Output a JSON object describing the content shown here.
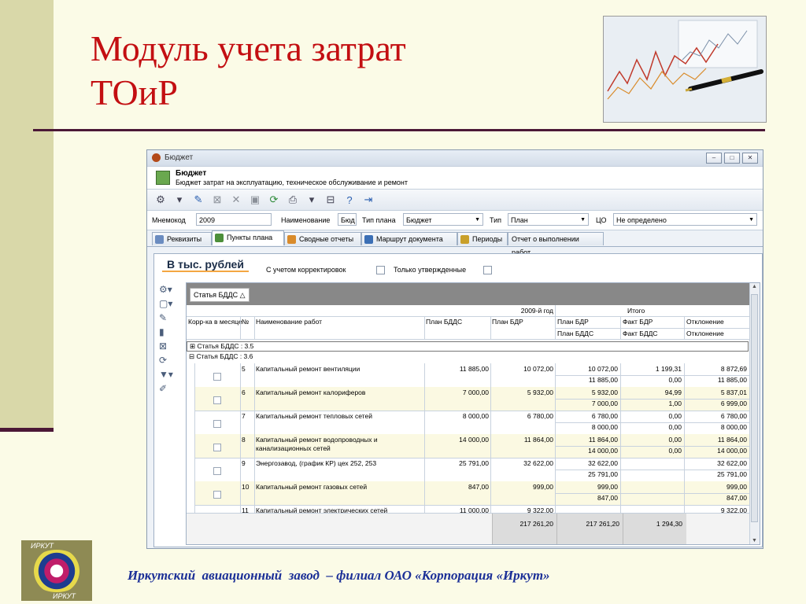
{
  "slide": {
    "title_line1": "Модуль учета затрат",
    "title_line2": "ТОиР",
    "footer": "Иркутский  авиационный  завод  – филиал ОАО «Корпорация «Иркут»",
    "logo_top": "ИРКУТ",
    "logo_bottom": "ИРКУТ"
  },
  "window": {
    "title": "Бюджет",
    "min_label": "–",
    "max_label": "□",
    "close_label": "✕",
    "header_title": "Бюджет",
    "header_subtitle": "Бюджет затрат на эксплуатацию, техническое обслуживание и ремонт"
  },
  "toolbar": {
    "items": [
      {
        "name": "settings-icon",
        "glyph": "⚙",
        "cls": ""
      },
      {
        "name": "dropdown-arrow-icon",
        "glyph": "▾",
        "cls": ""
      },
      {
        "name": "edit-icon",
        "glyph": "✎",
        "cls": "blue"
      },
      {
        "name": "cancel-icon",
        "glyph": "⊠",
        "cls": "grey"
      },
      {
        "name": "delete-icon",
        "glyph": "✕",
        "cls": "grey"
      },
      {
        "name": "save-icon",
        "glyph": "▣",
        "cls": "grey"
      },
      {
        "name": "refresh-icon",
        "glyph": "⟳",
        "cls": "green"
      },
      {
        "name": "print-icon",
        "glyph": "⎙",
        "cls": ""
      },
      {
        "name": "dropdown-arrow-icon",
        "glyph": "▾",
        "cls": ""
      },
      {
        "name": "export-icon",
        "glyph": "⊟",
        "cls": ""
      },
      {
        "name": "help-icon",
        "glyph": "?",
        "cls": "blue"
      },
      {
        "name": "exit-icon",
        "glyph": "⇥",
        "cls": "blue"
      }
    ]
  },
  "filters": {
    "mnemo_label": "Мнемокод",
    "mnemo_value": "2009",
    "name_label": "Наименование",
    "name_value": "Бюд",
    "plan_type_label": "Тип плана",
    "plan_type_value": "Бюджет",
    "type_label": "Тип",
    "type_value": "План",
    "cfo_label": "ЦО",
    "cfo_value": "Не определено"
  },
  "tabs": [
    {
      "label": "Реквизиты",
      "color": "#6b8cc0",
      "active": false
    },
    {
      "label": "Пункты плана",
      "color": "#4d8f3a",
      "active": true
    },
    {
      "label": "Сводные отчеты",
      "color": "#d98b2b",
      "active": false
    },
    {
      "label": "Маршрут документа",
      "color": "#3b6fb5",
      "active": false
    },
    {
      "label": "Периоды",
      "color": "#c9a02a",
      "active": false
    },
    {
      "label": "Отчет о выполнении работ",
      "color": "",
      "active": false
    }
  ],
  "panel": {
    "unit_label": "В тыс. рублей",
    "with_corrections": "С учетом корректировок",
    "only_approved": "Только утвержденные",
    "group_chip": "Статья БДДС △"
  },
  "side_icons": [
    {
      "name": "settings-icon",
      "glyph": "⚙▾"
    },
    {
      "name": "new-document-icon",
      "glyph": "▢▾"
    },
    {
      "name": "edit-icon",
      "glyph": "✎"
    },
    {
      "name": "trash-icon",
      "glyph": "▮"
    },
    {
      "name": "cancel-icon",
      "glyph": "⊠"
    },
    {
      "name": "refresh-icon",
      "glyph": "⟳"
    },
    {
      "name": "filter-icon",
      "glyph": "▼▾"
    },
    {
      "name": "edit-multiple-icon",
      "glyph": "✐"
    }
  ],
  "grid": {
    "year_header": "2009-й год",
    "total_header": "Итого",
    "col_corr": "Корр-ка в месяце",
    "col_num": "№",
    "col_name": "Наименование работ",
    "col_plan_bdds": "План БДДС",
    "col_plan_bdr": "План БДР",
    "total_plan_bdr": "План БДР",
    "total_plan_bdds": "План БДДС",
    "total_fact_bdr": "Факт БДР",
    "total_fact_bdds": "Факт БДДС",
    "total_dev1": "Отклонение",
    "total_dev2": "Отклонение",
    "group1": "⊞  Статья БДДС : 3.5",
    "group2": "⊟  Статья БДДС : 3.6",
    "rows": [
      {
        "num": "5",
        "name": "Капитальный ремонт вентиляции",
        "name2": "",
        "plan_bdds": "11 885,00",
        "plan_bdr": "10 072,00",
        "t_plan1": "10 072,00",
        "t_fact1": "1 199,31",
        "t_dev1": "8 872,69",
        "t_plan2": "11 885,00",
        "t_fact2": "0,00",
        "t_dev2": "11 885,00",
        "shade": false
      },
      {
        "num": "6",
        "name": "Капитальный ремонт калориферов",
        "name2": "",
        "plan_bdds": "7 000,00",
        "plan_bdr": "5 932,00",
        "t_plan1": "5 932,00",
        "t_fact1": "94,99",
        "t_dev1": "5 837,01",
        "t_plan2": "7 000,00",
        "t_fact2": "1,00",
        "t_dev2": "6 999,00",
        "shade": true
      },
      {
        "num": "7",
        "name": "Капитальный ремонт тепловых сетей",
        "name2": "",
        "plan_bdds": "8 000,00",
        "plan_bdr": "6 780,00",
        "t_plan1": "6 780,00",
        "t_fact1": "0,00",
        "t_dev1": "6 780,00",
        "t_plan2": "8 000,00",
        "t_fact2": "0,00",
        "t_dev2": "8 000,00",
        "shade": false
      },
      {
        "num": "8",
        "name": "Капитальный ремонт водопроводных и",
        "name2": "канализационных сетей",
        "plan_bdds": "14 000,00",
        "plan_bdr": "11 864,00",
        "t_plan1": "11 864,00",
        "t_fact1": "0,00",
        "t_dev1": "11 864,00",
        "t_plan2": "14 000,00",
        "t_fact2": "0,00",
        "t_dev2": "14 000,00",
        "shade": true
      },
      {
        "num": "9",
        "name": "Энергозавод, (график КР) цех 252, 253",
        "name2": "",
        "plan_bdds": "25 791,00",
        "plan_bdr": "32 622,00",
        "t_plan1": "32 622,00",
        "t_fact1": "",
        "t_dev1": "32 622,00",
        "t_plan2": "25 791,00",
        "t_fact2": "",
        "t_dev2": "25 791,00",
        "shade": false
      },
      {
        "num": "10",
        "name": "Капитальный ремонт газовых сетей",
        "name2": "",
        "plan_bdds": "847,00",
        "plan_bdr": "999,00",
        "t_plan1": "999,00",
        "t_fact1": "",
        "t_dev1": "999,00",
        "t_plan2": "847,00",
        "t_fact2": "",
        "t_dev2": "847,00",
        "shade": true
      },
      {
        "num": "11",
        "name": "Капитальный ремонт электрических сетей",
        "name2": "",
        "plan_bdds": "11 000,00",
        "plan_bdr": "9 322,00",
        "t_plan1": "",
        "t_fact1": "",
        "t_dev1": "9 322,00",
        "t_plan2": "",
        "t_fact2": "",
        "t_dev2": "",
        "shade": false
      }
    ],
    "footer_plan_bdr": "217 261,20",
    "footer_total_plan": "217 261,20",
    "footer_total_fact": "1 294,30"
  }
}
